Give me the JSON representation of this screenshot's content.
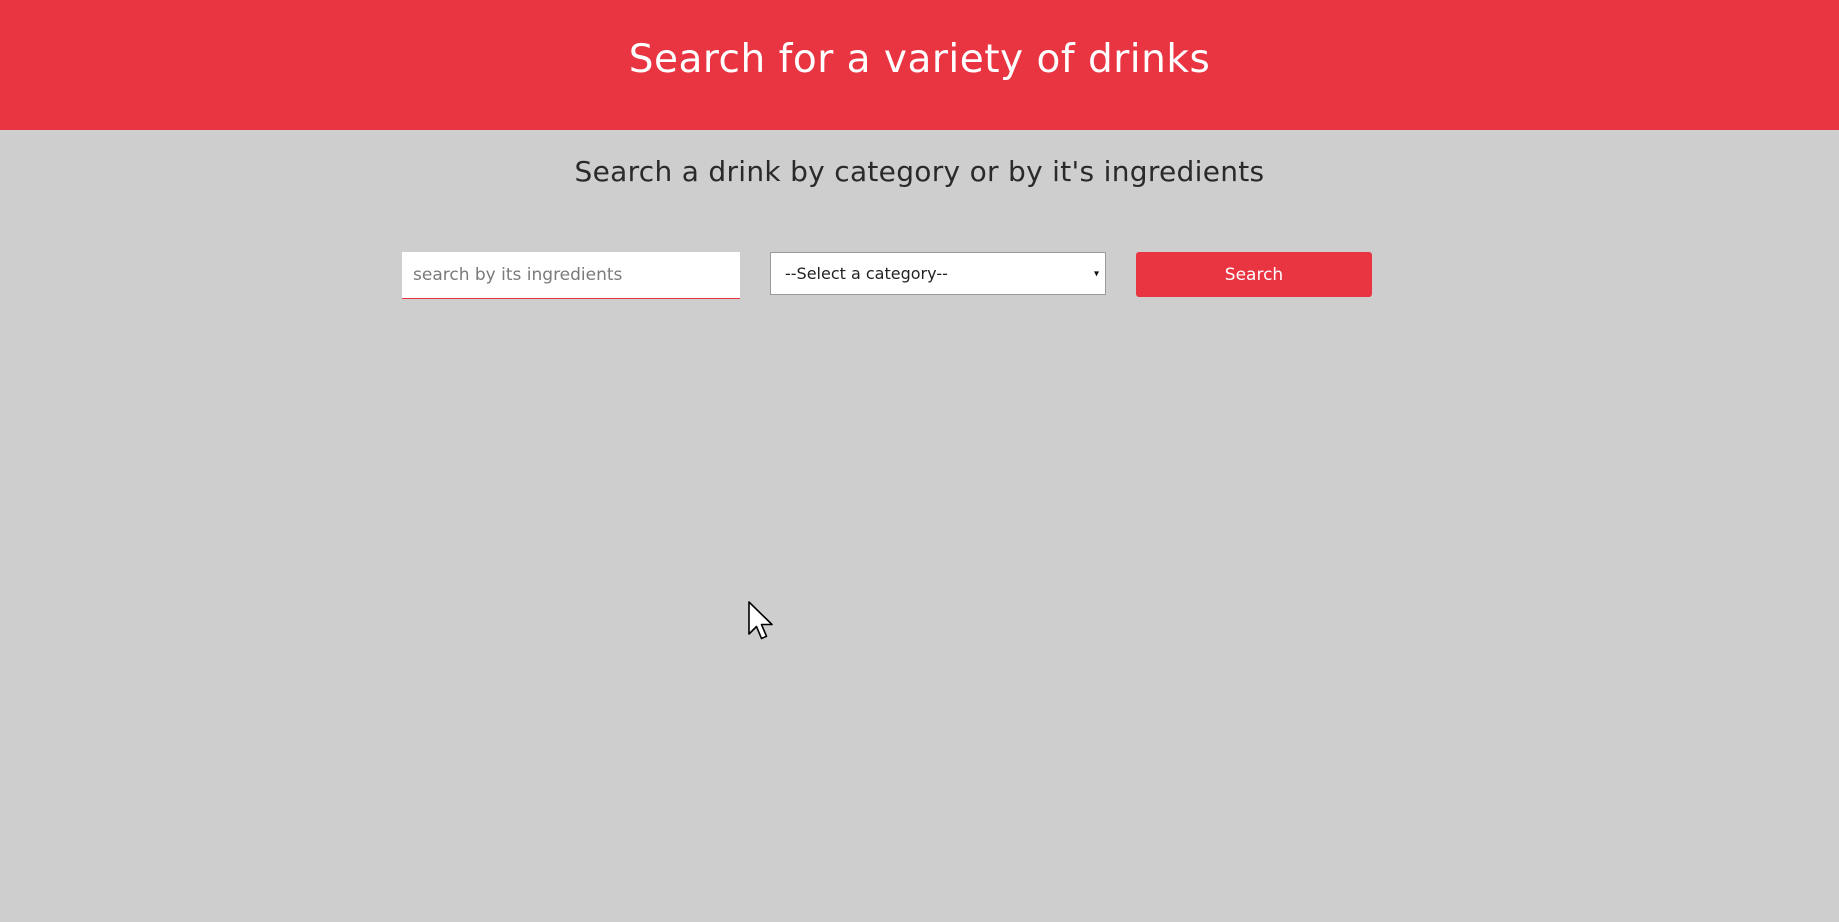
{
  "header": {
    "title": "Search for a variety of drinks"
  },
  "main": {
    "subtitle": "Search a drink by category or by it's ingredients",
    "search": {
      "ingredient_placeholder": "search by its ingredients",
      "ingredient_value": "",
      "category_selected": "--Select a category--",
      "button_label": "Search"
    }
  },
  "colors": {
    "accent": "#e93442",
    "background": "#cecece",
    "header_text": "#ffffff",
    "subtitle_text": "#2a2a2a"
  },
  "icons": {
    "dropdown": "chevron-down-icon",
    "pointer": "mouse-cursor-icon"
  }
}
